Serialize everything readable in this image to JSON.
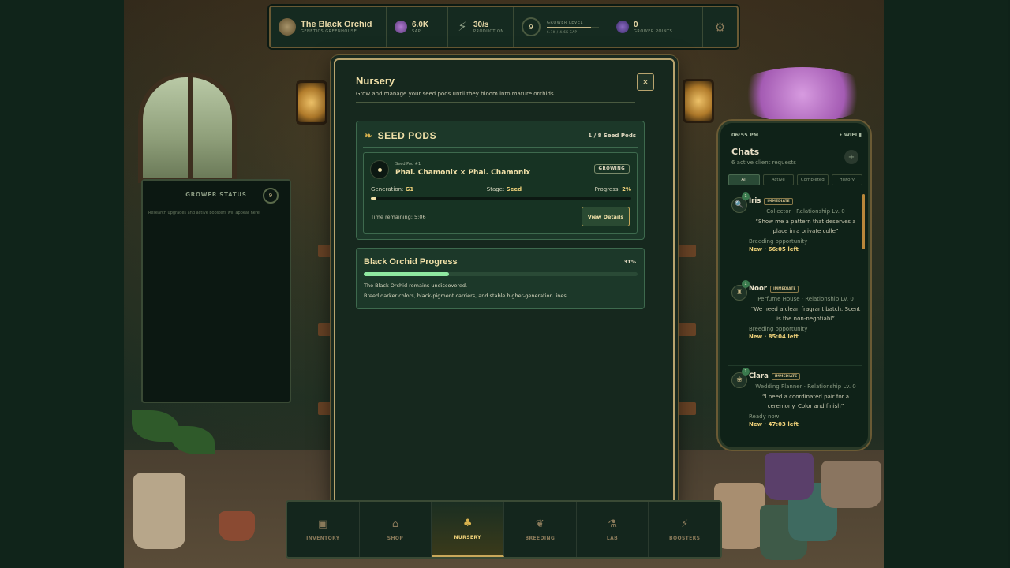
{
  "hud": {
    "brand_title": "The Black Orchid",
    "brand_sub": "GENETICS GREENHOUSE",
    "sap_value": "6.0K",
    "sap_label": "SAP",
    "production_value": "30/s",
    "production_label": "PRODUCTION",
    "level": "9",
    "level_label": "GROWER LEVEL",
    "level_xp": "6.1K / 4.6K Sap",
    "level_progress": 0.85,
    "points_value": "0",
    "points_label": "GROWER POINTS",
    "settings_icon": "gear-icon"
  },
  "grower_status": {
    "title": "GROWER STATUS",
    "badge": "9",
    "description": "Research upgrades and active boosters will appear here."
  },
  "nursery": {
    "title": "Nursery",
    "subtitle": "Grow and manage your seed pods until they bloom into mature orchids.",
    "close_label": "×",
    "seed_pods": {
      "title": "SEED PODS",
      "count": "1 / 8 Seed Pods",
      "pod": {
        "label": "Seed Pod #1",
        "name": "Phal. Chamonix × Phal. Chamonix",
        "status": "GROWING",
        "generation_label": "Generation:",
        "generation": "G1",
        "stage_label": "Stage:",
        "stage": "Seed",
        "progress_label": "Progress:",
        "progress": "2%",
        "progress_value": 0.02,
        "time_remaining": "Time remaining: 5:06",
        "details_button": "View Details"
      }
    },
    "orchid_progress": {
      "title": "Black Orchid Progress",
      "percent": "31%",
      "value": 0.31,
      "line1": "The Black Orchid remains undiscovered.",
      "line2": "Breed darker colors, black-pigment carriers, and stable higher-generation lines."
    }
  },
  "phone": {
    "time": "06:55 PM",
    "signal": "• WIFI ▮",
    "title": "Chats",
    "subtitle": "6 active client requests",
    "plus": "+",
    "tabs": [
      "All",
      "Active",
      "Completed",
      "History"
    ],
    "chats": [
      {
        "name": "Iris",
        "tag": "IMMEDIATE",
        "role": "Collector · Relationship Lv. 0",
        "quote": "“Show me a pattern that deserves a place in a private colle”",
        "opportunity": "Breeding opportunity",
        "time": "New · 66:05 left",
        "icon": "magnifier-icon",
        "glyph": "🔍",
        "badge": "1"
      },
      {
        "name": "Noor",
        "tag": "IMMEDIATE",
        "role": "Perfume House · Relationship Lv. 0",
        "quote": "“We need a clean fragrant batch. Scent is the non-negotiabl”",
        "opportunity": "Breeding opportunity",
        "time": "New · 85:04 left",
        "icon": "perfume-bottle-icon",
        "glyph": "♜",
        "badge": "1"
      },
      {
        "name": "Clara",
        "tag": "IMMEDIATE",
        "role": "Wedding Planner · Relationship Lv. 0",
        "quote": "“I need a coordinated pair for a ceremony. Color and finish”",
        "opportunity": "Ready now",
        "time": "New · 47:03 left",
        "icon": "bouquet-icon",
        "glyph": "❀",
        "badge": "1"
      }
    ]
  },
  "nav": {
    "items": [
      {
        "label": "INVENTORY",
        "icon": "chest-icon",
        "glyph": "▣"
      },
      {
        "label": "SHOP",
        "icon": "shop-icon",
        "glyph": "⌂"
      },
      {
        "label": "NURSERY",
        "icon": "nursery-icon",
        "glyph": "♣"
      },
      {
        "label": "BREEDING",
        "icon": "leaf-icon",
        "glyph": "❦"
      },
      {
        "label": "LAB",
        "icon": "flask-icon",
        "glyph": "⚗"
      },
      {
        "label": "BOOSTERS",
        "icon": "lightning-icon",
        "glyph": "⚡"
      }
    ],
    "active_index": 2
  },
  "colors": {
    "accent_gold": "#f0e0a8",
    "panel_green": "#1c3829",
    "progress_green": "#8fe8a0"
  }
}
